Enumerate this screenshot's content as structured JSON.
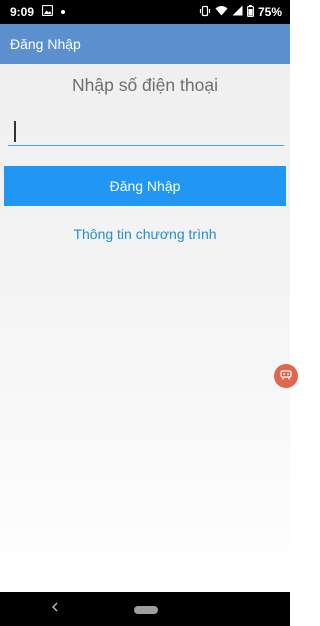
{
  "status_bar": {
    "time": "9:09",
    "battery_percent": "75%",
    "icons": [
      "image-notification-icon",
      "notification-dot-icon",
      "vibrate-icon",
      "wifi-icon",
      "signal-icon",
      "battery-icon"
    ]
  },
  "app_bar": {
    "title": "Đăng Nhập"
  },
  "login": {
    "heading": "Nhập số điện thoại",
    "phone_value": "",
    "button_label": "Đăng Nhập",
    "info_link": "Thông tin chương trình"
  },
  "colors": {
    "app_bar": "#5b8fce",
    "button": "#2196f3",
    "link": "#1f8fd6",
    "floating_button": "#e0674f"
  },
  "floating_button": {
    "icon": "floating-chat-icon"
  },
  "nav_bar": {
    "icons": [
      "back-icon",
      "home-pill"
    ]
  }
}
